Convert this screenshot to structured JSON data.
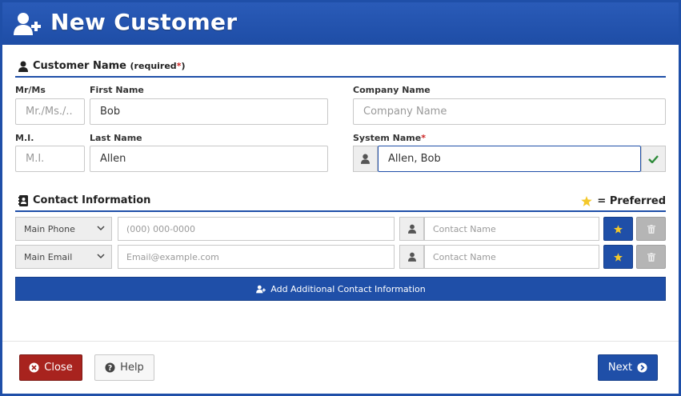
{
  "title": "New Customer",
  "customer_section": {
    "title": "Customer Name",
    "required_text": "(required",
    "required_star": "*",
    "required_close": ")"
  },
  "fields": {
    "mr_ms": {
      "label": "Mr/Ms",
      "placeholder": "Mr./Ms./..",
      "value": ""
    },
    "first_name": {
      "label": "First Name",
      "placeholder": "",
      "value": "Bob"
    },
    "mi": {
      "label": "M.I.",
      "placeholder": "M.I.",
      "value": ""
    },
    "last_name": {
      "label": "Last Name",
      "placeholder": "",
      "value": "Allen"
    },
    "company_name": {
      "label": "Company Name",
      "placeholder": "Company Name",
      "value": ""
    },
    "system_name": {
      "label": "System Name",
      "required_star": "*",
      "placeholder": "",
      "value": "Allen, Bob"
    }
  },
  "contact_section": {
    "title": "Contact Information",
    "preferred_legend": "= Preferred"
  },
  "contact_rows": [
    {
      "type": "Main Phone",
      "placeholder": "(000) 000-0000",
      "contact_placeholder": "Contact Name"
    },
    {
      "type": "Main Email",
      "placeholder": "Email@example.com",
      "contact_placeholder": "Contact Name"
    }
  ],
  "add_contact_label": "Add Additional Contact Information",
  "buttons": {
    "close": "Close",
    "help": "Help",
    "next": "Next"
  },
  "colors": {
    "primary": "#1f4fa8",
    "danger": "#a8231e",
    "success": "#2e8b3a",
    "star": "#f4c82a"
  }
}
